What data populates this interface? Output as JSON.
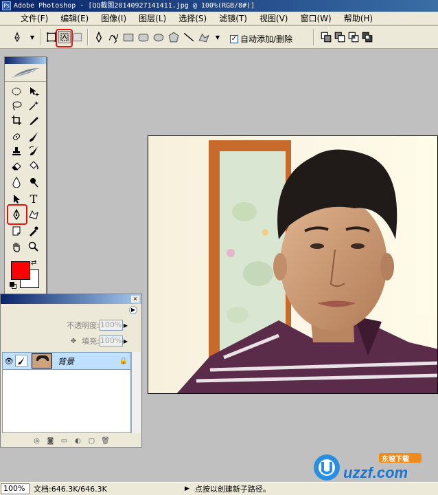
{
  "window": {
    "title": "Adobe Photoshop - [QQ截图20140927141411.jpg @ 100%(RGB/8#)]",
    "app_icon": "Ps"
  },
  "menu": [
    "文件(F)",
    "编辑(E)",
    "图像(I)",
    "图层(L)",
    "选择(S)",
    "滤镜(T)",
    "视图(V)",
    "窗口(W)",
    "帮助(H)"
  ],
  "options_bar": {
    "auto_add_delete_label": "自动添加/删除",
    "auto_add_delete_checked": true,
    "check_mark": "✓"
  },
  "toolbox": {
    "foreground_color": "#ff0000",
    "background_color": "#ffffff",
    "text_tool_glyph": "T",
    "selected_tool": "pen-tool"
  },
  "layers_panel": {
    "opacity_label": "不透明度:",
    "opacity_value": "100%",
    "fill_label": "填充:",
    "fill_value": "100%",
    "layers": [
      {
        "name": "背景",
        "locked": true,
        "visible": true
      }
    ]
  },
  "status_bar": {
    "zoom": "100%",
    "document": "文档:646.3K/646.3K",
    "hint": "点按以创建新子路径。"
  },
  "watermark": {
    "brand": "uzzf.com",
    "tagline": "东坡下载"
  },
  "colors": {
    "highlight_red": "#e81010",
    "title_blue": "#0a246a",
    "chrome": "#ece9d8"
  }
}
